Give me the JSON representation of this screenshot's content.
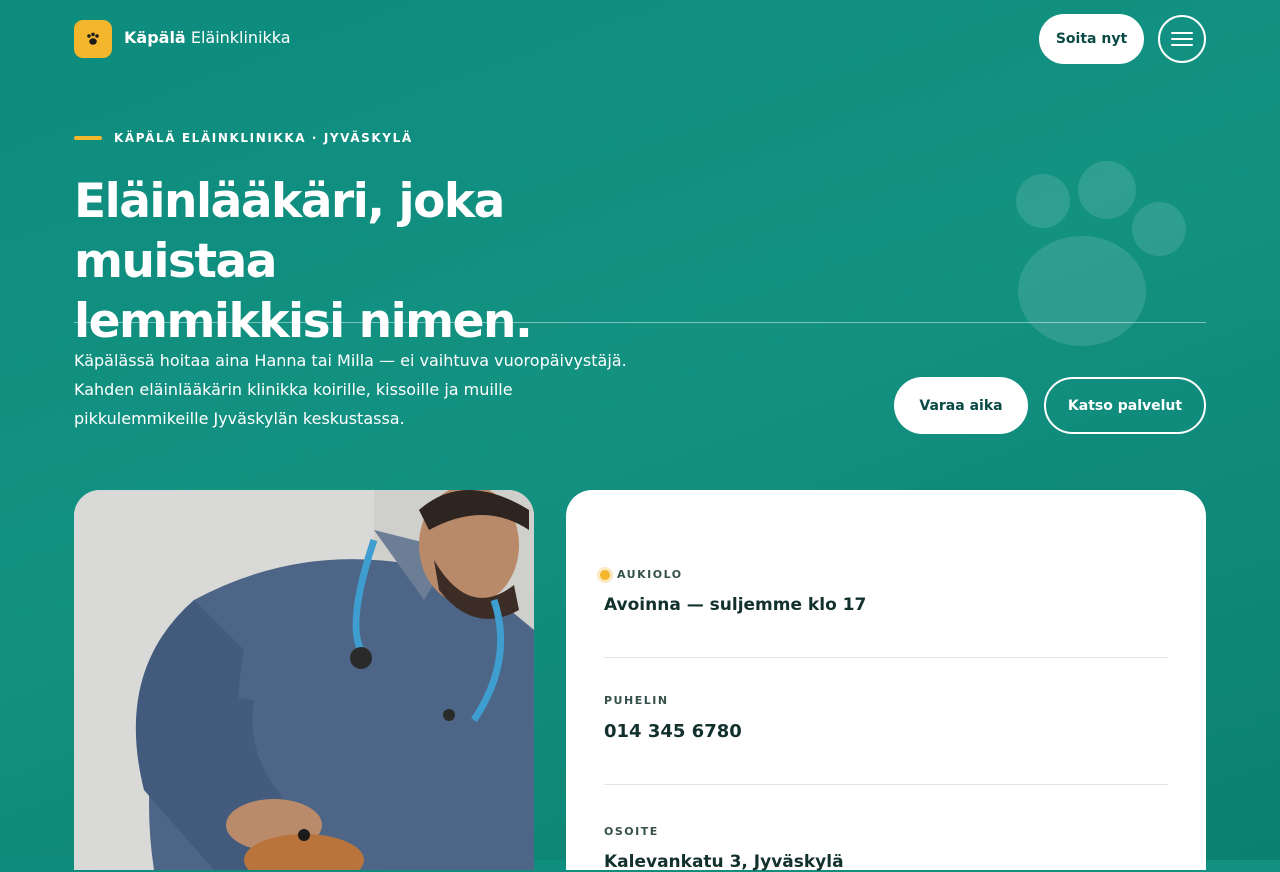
{
  "header": {
    "brand_strong": "Käpälä",
    "brand_rest": "Eläinklinikka",
    "call_label": "Soita nyt",
    "logo_icon": "paw-icon",
    "menu_icon": "hamburger-icon"
  },
  "hero": {
    "eyebrow": "KÄPÄLÄ ELÄINKLINIKKA · JYVÄSKYLÄ",
    "title_line1": "Eläinlääkäri, joka muistaa",
    "title_line2": "lemmikkisi nimen.",
    "lead_line1": "Käpälässä hoitaa aina Hanna tai Milla — ei vaihtuva vuoropäivystäjä.",
    "lead_line2": "Kahden eläinlääkärin klinikka koirille, kissoille ja muille",
    "lead_line3": "pikkulemmikeille Jyväskylän keskustassa.",
    "primary_cta": "Varaa aika",
    "secondary_cta": "Katso palvelut"
  },
  "info_card": {
    "hours_label": "AUKIOLO",
    "hours_value": "Avoinna — suljemme klo 17",
    "phone_label": "PUHELIN",
    "phone_value": "014 345 6780",
    "address_label": "OSOITE",
    "address_value": "Kalevankatu 3, Jyväskylä"
  },
  "colors": {
    "background": "#0e8b7c",
    "accent": "#f4b62c",
    "dark_text": "#12302c"
  }
}
